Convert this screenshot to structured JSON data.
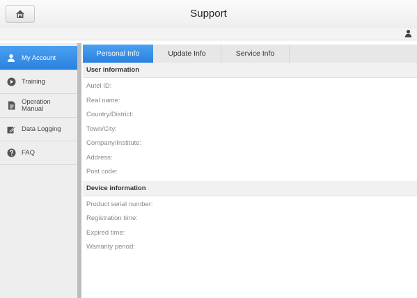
{
  "header": {
    "title": "Support"
  },
  "sidebar": {
    "items": [
      {
        "label": "My Account",
        "icon": "user-icon"
      },
      {
        "label": "Training",
        "icon": "play-icon"
      },
      {
        "label": "Operation Manual",
        "label_line1": "Operation",
        "label_line2": "Manual",
        "icon": "document-icon"
      },
      {
        "label": "Data Logging",
        "icon": "edit-icon"
      },
      {
        "label": "FAQ",
        "icon": "help-icon"
      }
    ]
  },
  "tabs": [
    {
      "label": "Personal Info"
    },
    {
      "label": "Update Info"
    },
    {
      "label": "Service Info"
    }
  ],
  "user_information": {
    "heading": "User information",
    "fields": [
      "Autel ID:",
      "Real name:",
      "Country/District:",
      "Town/City:",
      "Company/Institute:",
      "Address:",
      "Post code:"
    ]
  },
  "device_information": {
    "heading": "Device information",
    "fields": [
      "Product serial number:",
      "Registration time:",
      "Expired time:",
      "Warranty period:"
    ]
  },
  "colors": {
    "accent": "#2a82e0",
    "sidebar_bg": "#eeeeee"
  }
}
